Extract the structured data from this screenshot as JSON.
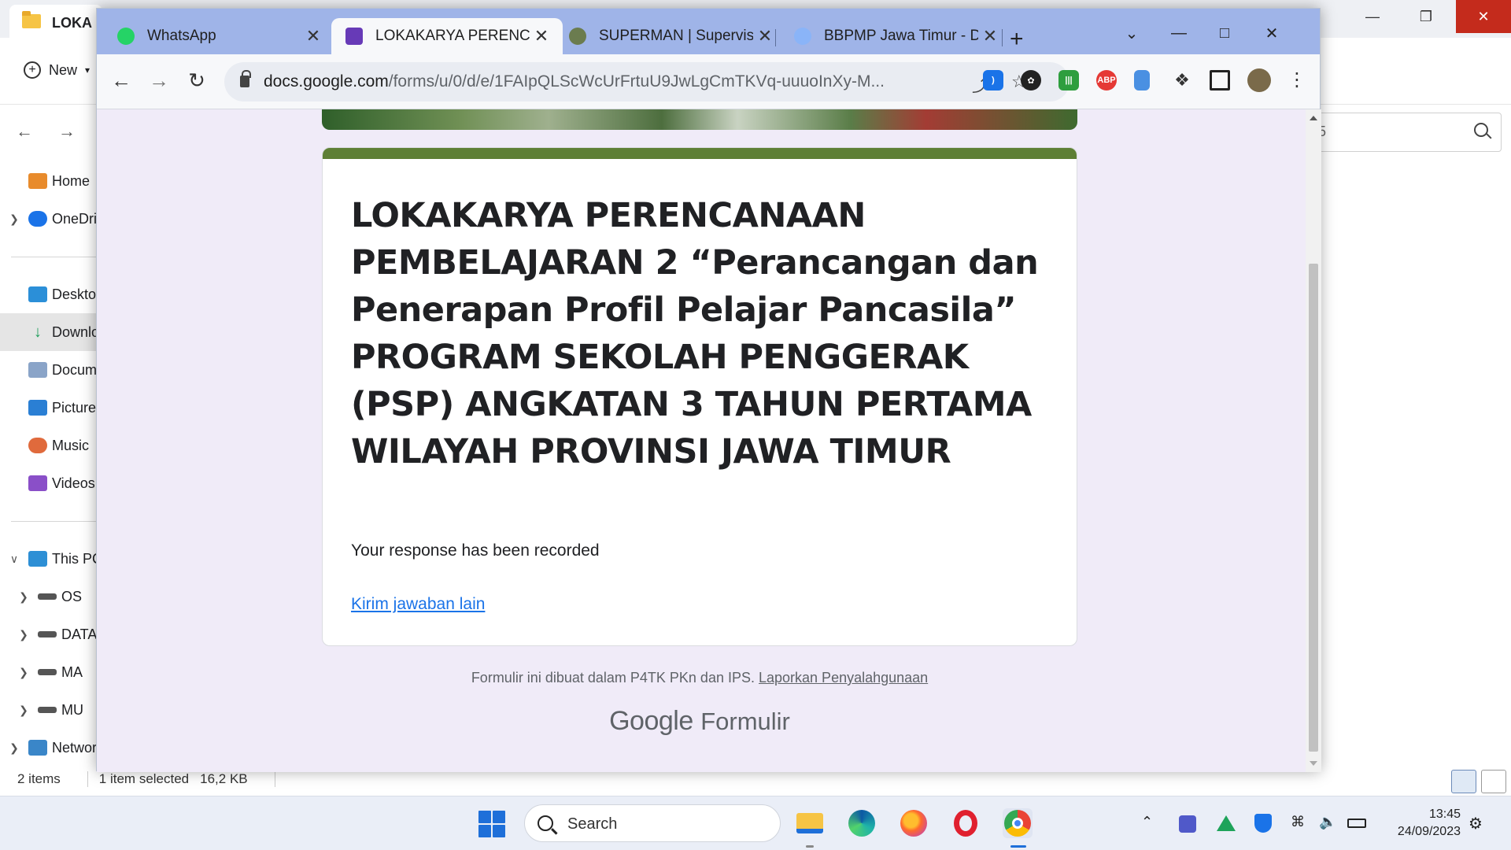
{
  "explorer": {
    "tab_title": "LOKA",
    "new_label": "New",
    "sidebar": [
      {
        "label": "Home",
        "icon": "home-icon"
      },
      {
        "label": "OneDrive",
        "icon": "onedrive-icon"
      },
      {
        "label": "Desktop",
        "icon": "desktop-icon"
      },
      {
        "label": "Downloads",
        "icon": "downloads-icon"
      },
      {
        "label": "Documents",
        "icon": "documents-icon"
      },
      {
        "label": "Pictures",
        "icon": "pictures-icon"
      },
      {
        "label": "Music",
        "icon": "music-icon"
      },
      {
        "label": "Videos",
        "icon": "videos-icon"
      },
      {
        "label": "This PC",
        "icon": "pc-icon"
      },
      {
        "label": "OS",
        "icon": "drive-icon"
      },
      {
        "label": "DATA",
        "icon": "drive-icon"
      },
      {
        "label": "MA",
        "icon": "drive-icon"
      },
      {
        "label": "MU",
        "icon": "drive-icon"
      },
      {
        "label": "Network",
        "icon": "network-icon"
      }
    ],
    "search_placeholder": "5",
    "status": {
      "items": "2 items",
      "selected": "1 item selected",
      "size": "16,2 KB"
    }
  },
  "browser": {
    "tabs": [
      {
        "label": "WhatsApp",
        "icon": "whatsapp-icon",
        "active": false
      },
      {
        "label": "LOKAKARYA PERENCANAAN",
        "icon": "google-forms-icon",
        "active": true
      },
      {
        "label": "SUPERMAN | Supervisi",
        "icon": "superman-icon",
        "active": false
      },
      {
        "label": "BBPMP Jawa Timur - D",
        "icon": "bbpmp-icon",
        "active": false
      }
    ],
    "url_host": "docs.google.com",
    "url_path": "/forms/u/0/d/e/1FAIpQLScWcUrFrtuU9JwLgCmTKVq-uuuoInXy-M...",
    "extensions": [
      "ext-blue",
      "chatgpt-icon",
      "ext-green",
      "ABP",
      "ext-phone",
      "puzzle-icon",
      "sidepanel-icon",
      "profile-avatar"
    ]
  },
  "form": {
    "title": "LOKAKARYA PERENCANAAN PEMBELAJARAN 2 “Perancangan dan Penerapan Profil Pelajar Pancasila” PROGRAM SEKOLAH PENGGERAK (PSP) ANGKATAN 3 TAHUN PERTAMA WILAYAH PROVINSI JAWA TIMUR",
    "response_text": "Your response has been recorded",
    "submit_another": "Kirim jawaban lain",
    "footer_text": "Formulir ini dibuat dalam P4TK PKn dan IPS.",
    "footer_link": "Laporkan Penyalahgunaan",
    "brand_google": "Google",
    "brand_forms": "Formulir",
    "accent_color": "#5e7f35",
    "background_color": "#f0ebf8"
  },
  "taskbar": {
    "search_label": "Search",
    "time": "13:45",
    "date": "24/09/2023"
  }
}
